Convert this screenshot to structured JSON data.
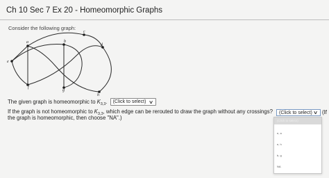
{
  "header": {
    "title": "Ch 10 Sec 7 Ex 20 - Homeomorphic Graphs"
  },
  "prompt": "Consider the following graph:",
  "graph": {
    "vertex_labels": [
      "a",
      "b",
      "c",
      "d",
      "e",
      "f",
      "g",
      "h"
    ]
  },
  "question1": {
    "prefix": "The given graph is homeomorphic to",
    "math": "K",
    "math_sub": "3,3",
    "suffix": ".",
    "select_value": "(Click to select)"
  },
  "question2": {
    "prefix": "If the graph is not homeomorphic to",
    "math": "K",
    "math_sub": "3,3",
    "suffix": ", which edge can be rerouted to draw the graph without any crossings?",
    "select_value": "(Click to select)",
    "after": "(If",
    "line2": "the graph is homeomorphic, then choose \"NA\".)"
  },
  "dropdown": {
    "header": "(Click to select)",
    "options": [
      "e, a",
      "e, h",
      "b, g",
      "NA"
    ]
  }
}
